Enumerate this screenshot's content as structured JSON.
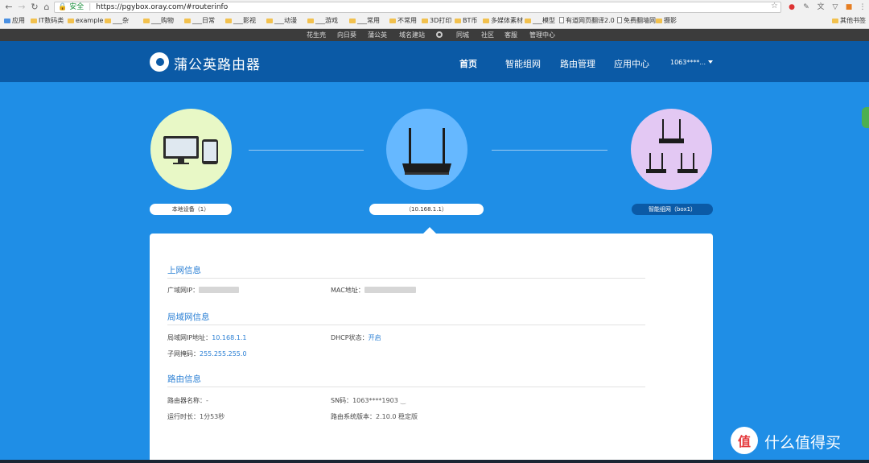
{
  "browser": {
    "url_secure_label": "安全",
    "url": "https://pgybox.oray.com/#routerinfo",
    "bookmarks": [
      "应用",
      "IT数码类",
      "example",
      "___杂",
      "___购物",
      "___日常",
      "___影视",
      "___动漫",
      "___游戏",
      "___常用",
      "不常用",
      "3D打印",
      "BT币",
      "多媒体素材",
      "___模型",
      "有道网页翻译2.0",
      "免费翻墙网",
      "摄影",
      "其他书签"
    ]
  },
  "topbar": {
    "links": [
      "花生壳",
      "向日葵",
      "蒲公英",
      "域名建站",
      "同城",
      "社区",
      "客服",
      "管理中心"
    ]
  },
  "header": {
    "logo_text": "蒲公英路由器",
    "nav": [
      "首页",
      "智能组网",
      "路由管理",
      "应用中心"
    ],
    "user": "1063****..."
  },
  "diagram": {
    "local_label": "本地设备（1）",
    "router_label": "（10.168.1.1）",
    "mesh_label": "智能组网（box1）"
  },
  "info": {
    "internet_title": "上网信息",
    "wan_ip_label": "广域网IP：",
    "mac_label": "MAC地址：",
    "lan_title": "局域网信息",
    "lan_ip_label": "局域网IP地址：",
    "lan_ip_value": "10.168.1.1",
    "dhcp_label": "DHCP状态：",
    "dhcp_value": "开启",
    "mask_label": "子网掩码：",
    "mask_value": "255.255.255.0",
    "router_title": "路由信息",
    "name_label": "路由器名称：",
    "name_value": "-",
    "sn_label": "SN码：",
    "sn_value": "1063****1903",
    "uptime_label": "运行时长：",
    "uptime_value": "1分53秒",
    "version_label": "路由系统版本：",
    "version_value": "2.10.0 稳定版"
  },
  "watermark": {
    "badge": "值",
    "text": "什么值得买"
  }
}
